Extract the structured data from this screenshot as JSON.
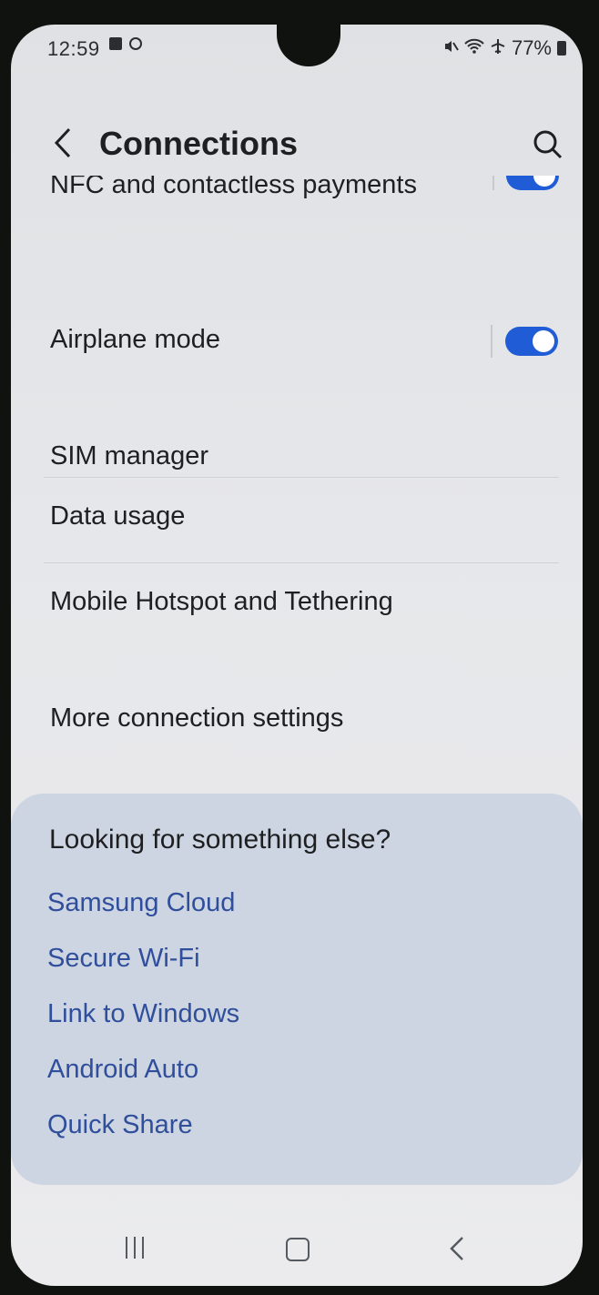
{
  "status_bar": {
    "time": "12:59",
    "battery": "77%"
  },
  "header": {
    "title": "Connections"
  },
  "settings": {
    "nfc_label": "NFC and contactless payments",
    "nfc_enabled": true,
    "airplane_label": "Airplane mode",
    "airplane_enabled": true,
    "sim_label": "SIM manager",
    "data_usage_label": "Data usage",
    "hotspot_label": "Mobile Hotspot and Tethering",
    "more_label": "More connection settings"
  },
  "suggestions": {
    "title": "Looking for something else?",
    "links": [
      "Samsung Cloud",
      "Secure Wi-Fi",
      "Link to Windows",
      "Android Auto",
      "Quick Share"
    ]
  },
  "colors": {
    "accent": "#1f5cd6",
    "link": "#2f4e9b",
    "suggest_bg": "#cdd5e2"
  },
  "icons": {
    "back": "chevron-left-icon",
    "search": "search-icon",
    "nav_recent": "recent-apps-icon",
    "nav_home": "home-icon",
    "nav_back": "back-icon"
  }
}
